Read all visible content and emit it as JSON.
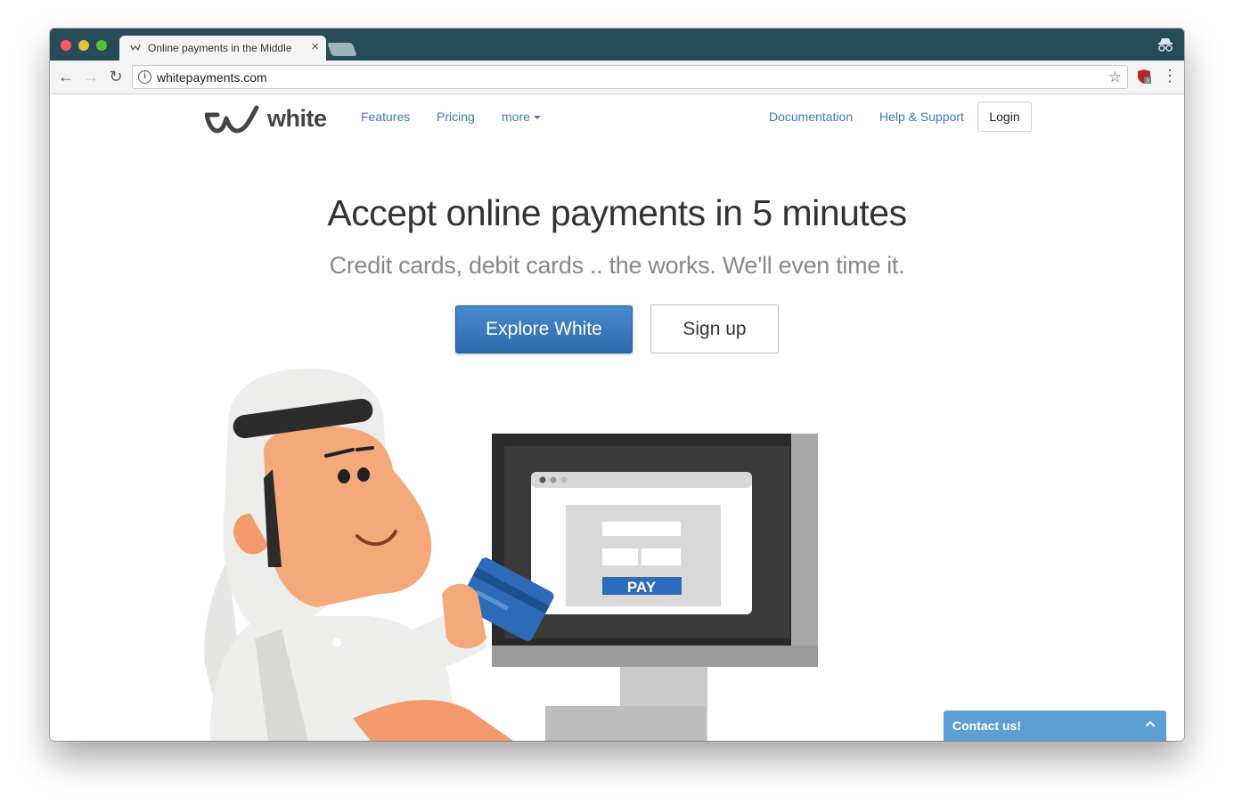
{
  "browser": {
    "tab_title": "Online payments in the Middle",
    "tab_close": "×",
    "url": "whitepayments.com",
    "back_glyph": "←",
    "forward_glyph": "→",
    "reload_glyph": "↻",
    "star_glyph": "☆",
    "info_glyph": "i",
    "menu_glyph": "⋮",
    "extension_badge": "3"
  },
  "nav": {
    "logo_text": "white",
    "features": "Features",
    "pricing": "Pricing",
    "more": "more",
    "documentation": "Documentation",
    "help_support": "Help & Support",
    "login": "Login"
  },
  "hero": {
    "title": "Accept online payments in 5 minutes",
    "subtitle": "Credit cards, debit cards .. the works. We'll even time it.",
    "explore_button": "Explore White",
    "signup_button": "Sign up"
  },
  "illustration": {
    "pay_label": "PAY"
  },
  "contact": {
    "label": "Contact us!"
  },
  "colors": {
    "titlebar": "#264d57",
    "link": "#3d7ab8",
    "primary_button": "#3777bd",
    "contact_bar": "#5d9fd4"
  }
}
